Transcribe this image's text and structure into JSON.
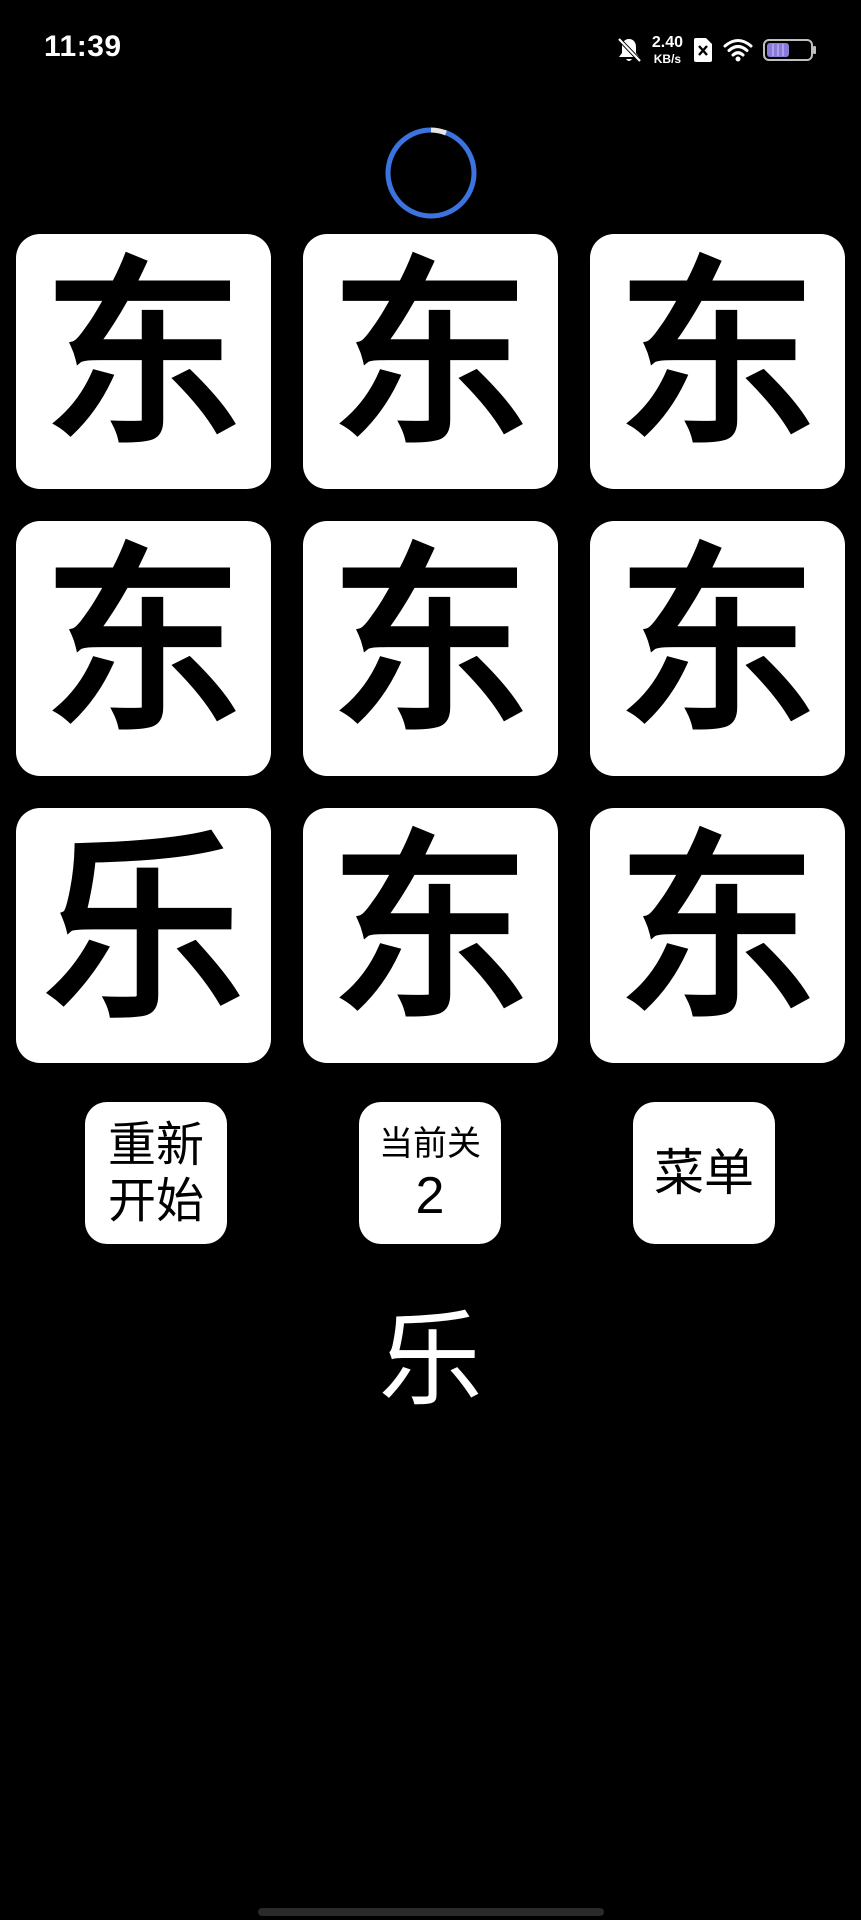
{
  "status_bar": {
    "time": "11:39",
    "net_speed_value": "2.40",
    "net_speed_unit": "KB/s",
    "icons": [
      "mute-bell-icon",
      "sim-x-icon",
      "wifi-icon",
      "battery-icon"
    ],
    "battery_color": "#8a7bd8"
  },
  "timer": {
    "ring_color": "#3b73e0",
    "remaining_fraction": 0.95
  },
  "grid": {
    "tiles": [
      {
        "char": "东"
      },
      {
        "char": "东"
      },
      {
        "char": "东"
      },
      {
        "char": "东"
      },
      {
        "char": "东"
      },
      {
        "char": "东"
      },
      {
        "char": "乐"
      },
      {
        "char": "东"
      },
      {
        "char": "东"
      }
    ]
  },
  "controls": {
    "restart_line1": "重新",
    "restart_line2": "开始",
    "level_label": "当前关",
    "level_value": "2",
    "menu_label": "菜单"
  },
  "target_char": "乐",
  "colors": {
    "background": "#000000",
    "tile": "#ffffff",
    "tile_text": "#000000",
    "accent": "#3b73e0"
  }
}
